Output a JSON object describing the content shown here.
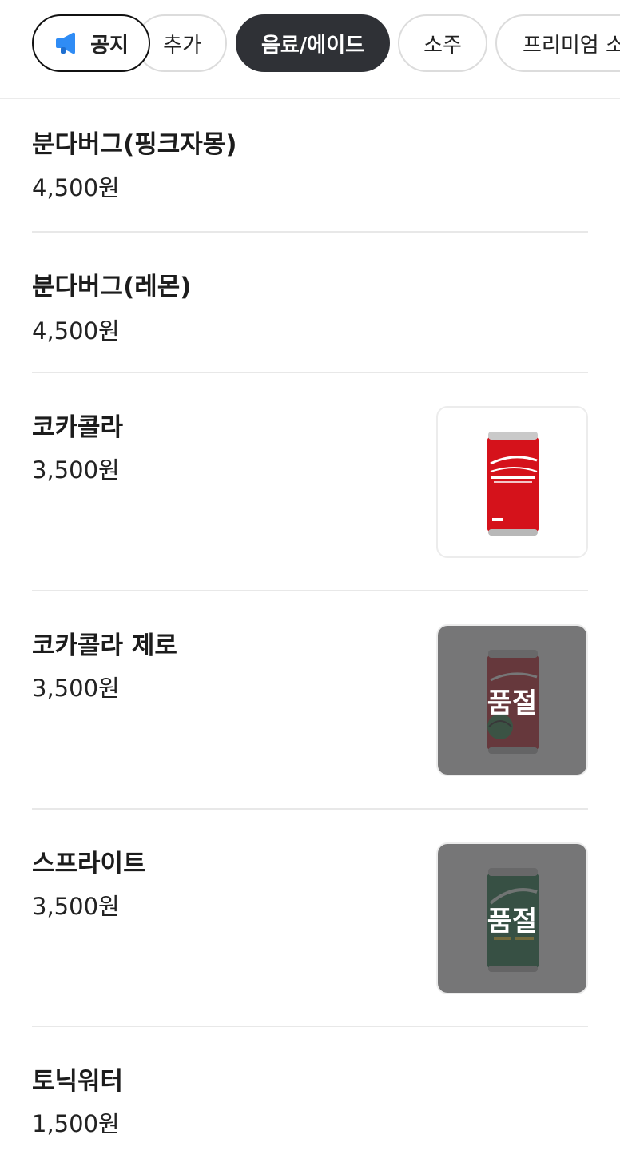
{
  "tabs": {
    "notice": "공지",
    "add": "추가",
    "drinks": "음료/에이드",
    "soju": "소주",
    "premium": "프리미엄 소"
  },
  "menu": [
    {
      "name": "분다버그(핑크자몽)",
      "price": "4,500원"
    },
    {
      "name": "분다버그(레몬)",
      "price": "4,500원"
    },
    {
      "name": "코카콜라",
      "price": "3,500원"
    },
    {
      "name": "코카콜라 제로",
      "price": "3,500원",
      "badge": "품절"
    },
    {
      "name": "스프라이트",
      "price": "3,500원",
      "badge": "품절"
    },
    {
      "name": "토닉워터",
      "price": "1,500원"
    }
  ],
  "colors": {
    "active_tab": "#2f3136",
    "speaker_icon": "#2f8cf5",
    "soldout_overlay": "#464648"
  }
}
